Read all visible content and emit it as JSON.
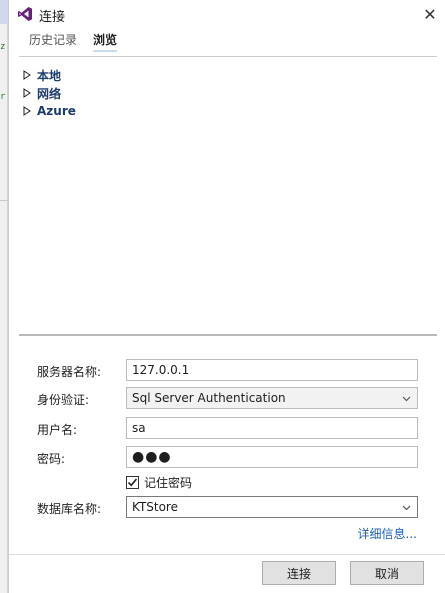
{
  "window": {
    "title": "连接",
    "close_glyph": "✕"
  },
  "tabs": [
    {
      "label": "历史记录",
      "active": false
    },
    {
      "label": "浏览",
      "active": true
    }
  ],
  "tree": {
    "items": [
      {
        "label": "本地"
      },
      {
        "label": "网络"
      },
      {
        "label": "Azure"
      }
    ]
  },
  "form": {
    "server_name": {
      "label": "服务器名称:",
      "value": "127.0.0.1"
    },
    "authentication": {
      "label": "身份验证:",
      "value": "Sql Server Authentication"
    },
    "username": {
      "label": "用户名:",
      "value": "sa"
    },
    "password": {
      "label": "密码:",
      "value": "●●●"
    },
    "remember_password": {
      "label": "记住密码",
      "checked": true
    },
    "database_name": {
      "label": "数据库名称:",
      "value": "KTStore"
    },
    "details_link": "详细信息..."
  },
  "buttons": {
    "connect": "连接",
    "cancel": "取消"
  },
  "colors": {
    "accent": "#68217a",
    "link": "#1e60b0",
    "tree_label": "#1e3c6e"
  },
  "icons": {
    "logo": "visual-studio-icon",
    "close": "close-icon",
    "expand": "expand-arrow-icon",
    "dropdown": "chevron-down-icon",
    "check": "checkmark-icon"
  }
}
